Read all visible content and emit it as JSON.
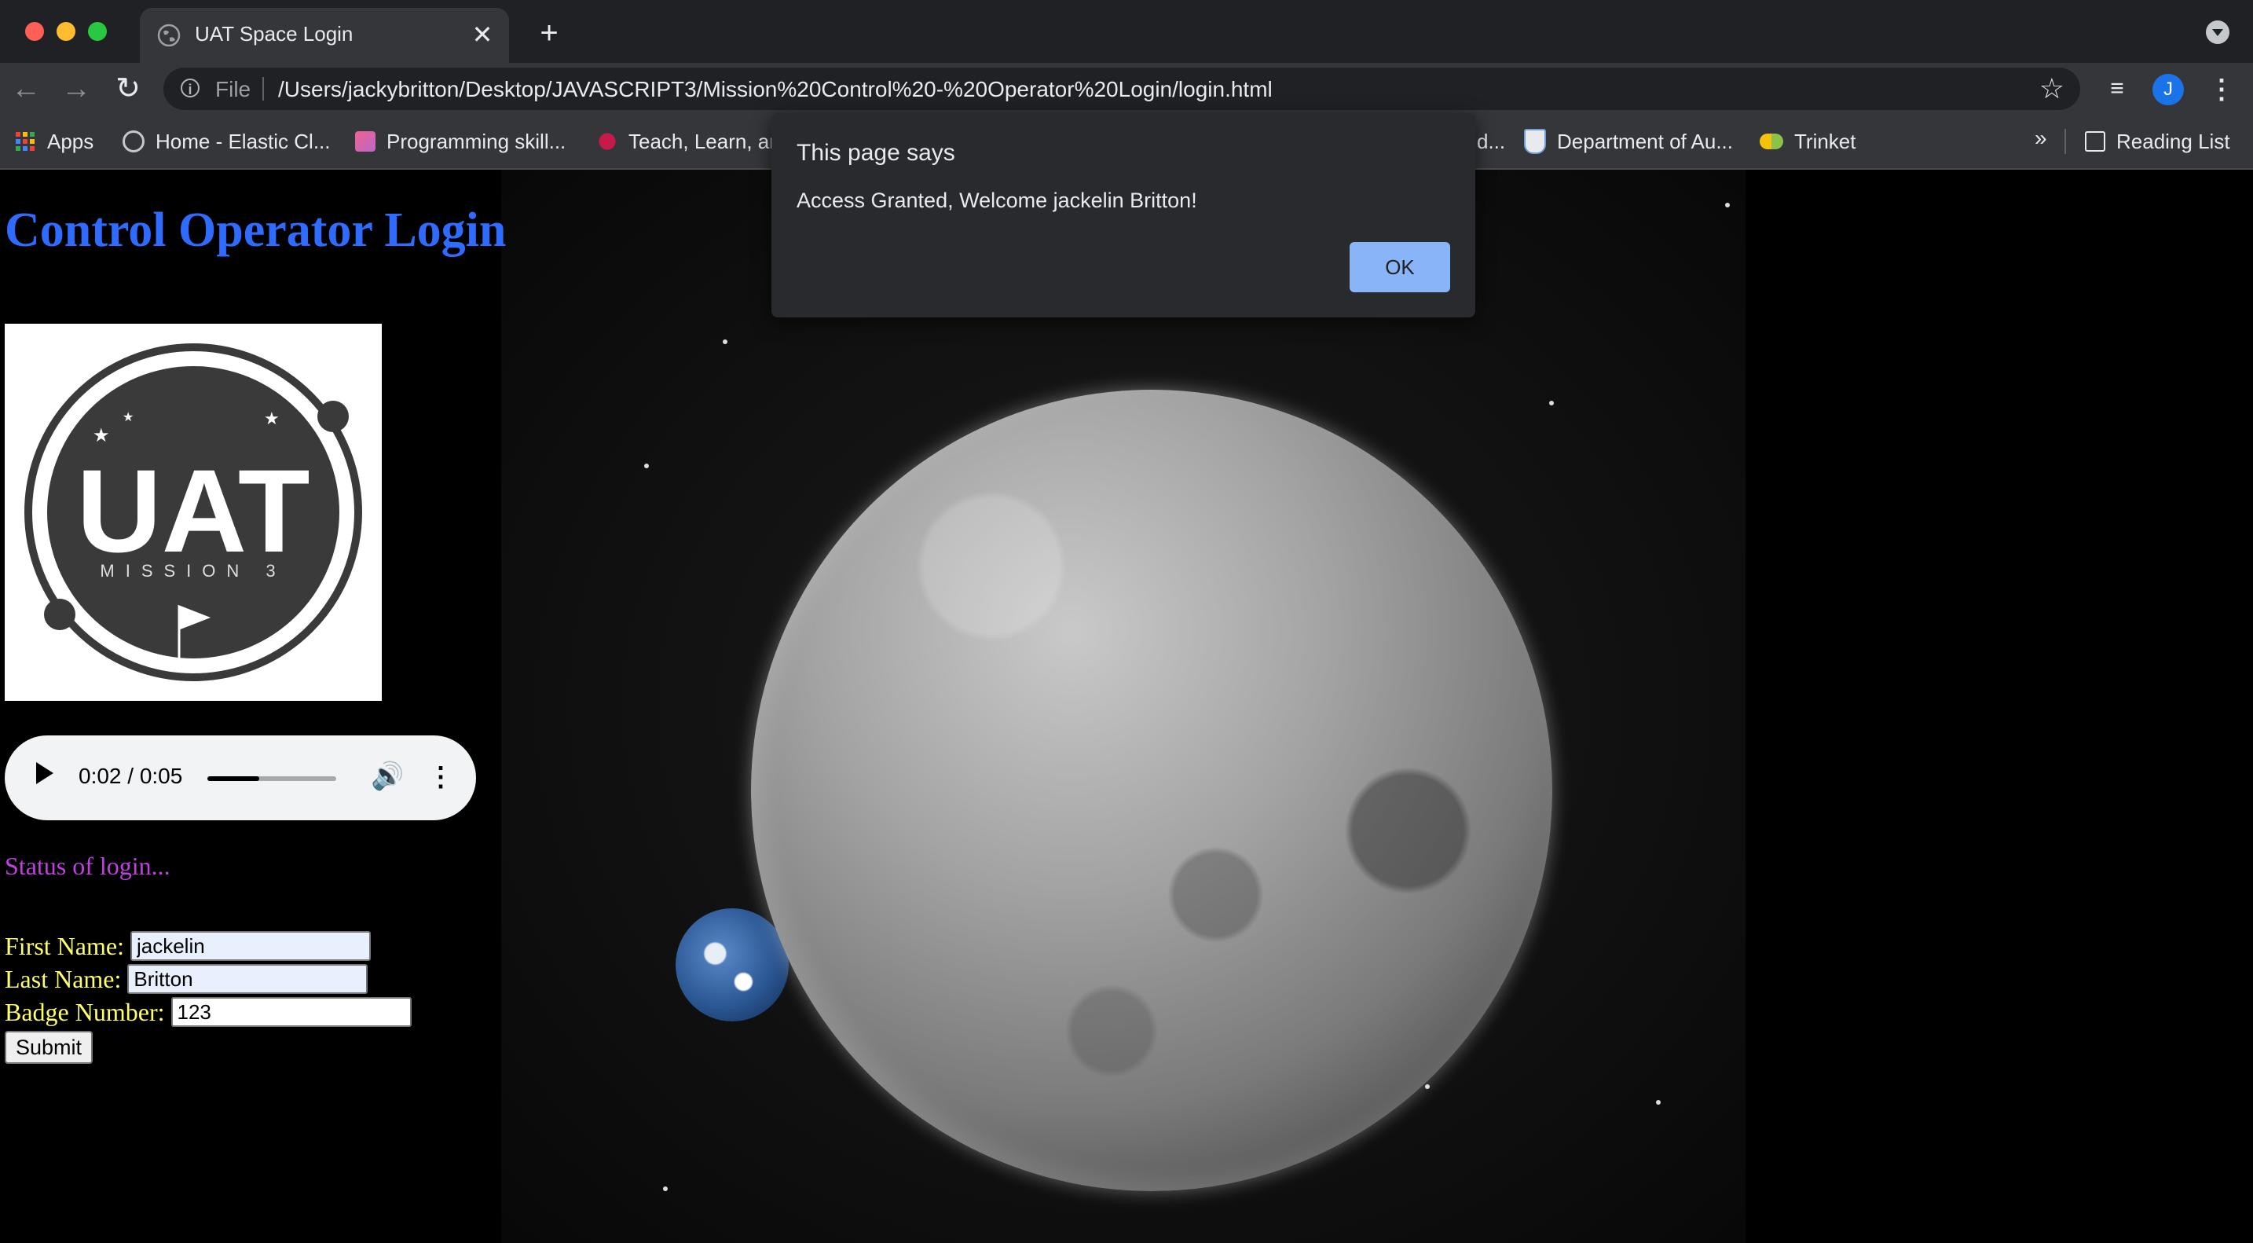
{
  "browser": {
    "tab_title": "UAT Space Login",
    "tab_close": "✕",
    "new_tab": "+",
    "scheme": "File",
    "url": "/Users/jackybritton/Desktop/JAVASCRIPT3/Mission%20Control%20-%20Operator%20Login/login.html",
    "profile_initial": "J",
    "bookmarks": [
      {
        "label": "Apps",
        "icon": "apps-grid-icon"
      },
      {
        "label": "Home - Elastic Cl...",
        "icon": "elastic-icon"
      },
      {
        "label": "Programming skill...",
        "icon": "programming-icon"
      },
      {
        "label": "Teach, Learn, ar",
        "icon": "raspberry-icon"
      },
      {
        "label": "d...",
        "icon": ""
      },
      {
        "label": "Department of Au...",
        "icon": "shield-icon"
      },
      {
        "label": "Trinket",
        "icon": "trinket-icon"
      }
    ],
    "overflow": "»",
    "reading_list": "Reading List"
  },
  "page": {
    "heading": "Control Operator Login",
    "logo": {
      "text": "UAT",
      "subtitle": "MISSION 3"
    },
    "audio": {
      "time": "0:02 / 0:05",
      "progress": 0.4
    },
    "status": "Status of login...",
    "form": {
      "first_name_label": "First Name:",
      "first_name_value": "jackelin",
      "last_name_label": "Last Name:",
      "last_name_value": "Britton",
      "badge_label": "Badge Number:",
      "badge_value": "123",
      "submit_label": "Submit"
    }
  },
  "dialog": {
    "title": "This page says",
    "message": "Access Granted, Welcome jackelin Britton!",
    "ok_label": "OK"
  },
  "colors": {
    "heading": "#2f6bff",
    "status": "#c040e0",
    "form_labels": "#ffff66",
    "dialog_ok": "#8ab4f8"
  }
}
